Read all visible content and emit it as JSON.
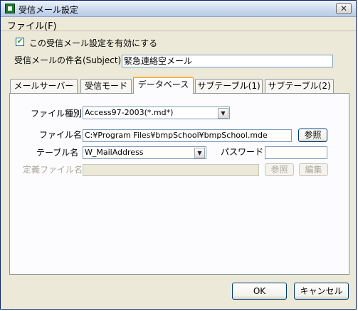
{
  "window": {
    "title": "受信メール設定",
    "close_glyph": "✕"
  },
  "menu": {
    "file": "ファイル(F)"
  },
  "enable": {
    "checked": true,
    "label": "この受信メール設定を有効にする"
  },
  "subject": {
    "label": "受信メールの件名(Subject)",
    "value": "緊急連絡空メール"
  },
  "tabs": [
    {
      "label": "メールサーバー",
      "active": false
    },
    {
      "label": "受信モード",
      "active": false
    },
    {
      "label": "データベース",
      "active": true
    },
    {
      "label": "サブテーブル(1)",
      "active": false
    },
    {
      "label": "サブテーブル(2)",
      "active": false
    }
  ],
  "db": {
    "filetype": {
      "label": "ファイル種別",
      "value": "Access97-2003(*.md*)"
    },
    "filename": {
      "label": "ファイル名",
      "value": "C:¥Program Files¥bmpSchool¥bmpSchool.mde",
      "browse": "参照"
    },
    "table": {
      "label": "テーブル名",
      "value": "W_MailAddress"
    },
    "password": {
      "label": "パスワード",
      "value": ""
    },
    "deffile": {
      "label": "定義ファイル名",
      "value": "",
      "browse": "参照",
      "edit": "編集"
    }
  },
  "buttons": {
    "ok": "OK",
    "cancel": "キャンセル"
  }
}
